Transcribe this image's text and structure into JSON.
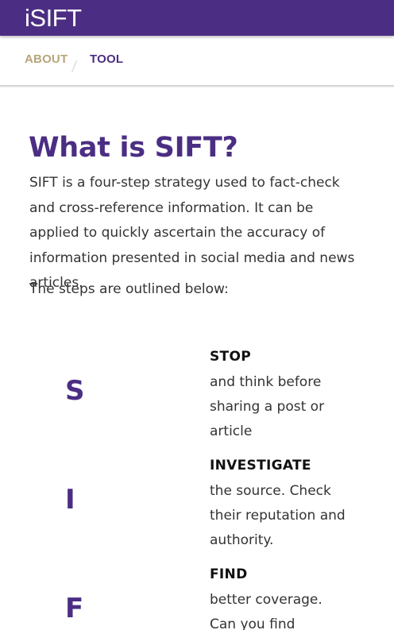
{
  "header": {
    "brand": "iSIFT"
  },
  "nav": {
    "items": [
      {
        "label": "ABOUT"
      },
      {
        "label": "TOOL"
      }
    ]
  },
  "main": {
    "title": "What is SIFT?",
    "intro": "SIFT is a four-step strategy used to fact-check and cross-reference information. It can be applied to quickly ascertain the accuracy of information presented in social media and news articles.",
    "steps_intro": "The steps are outlined below:",
    "steps": [
      {
        "letter": "S",
        "title": "STOP",
        "description": "and think before sharing a post or article"
      },
      {
        "letter": "I",
        "title": "INVESTIGATE",
        "description": "the source. Check their reputation and authority."
      },
      {
        "letter": "F",
        "title": "FIND",
        "description": "better coverage. Can you find"
      }
    ]
  },
  "colors": {
    "brand_purple": "#4b2e83",
    "nav_gold": "#b7a57a",
    "body_text": "#333333"
  }
}
